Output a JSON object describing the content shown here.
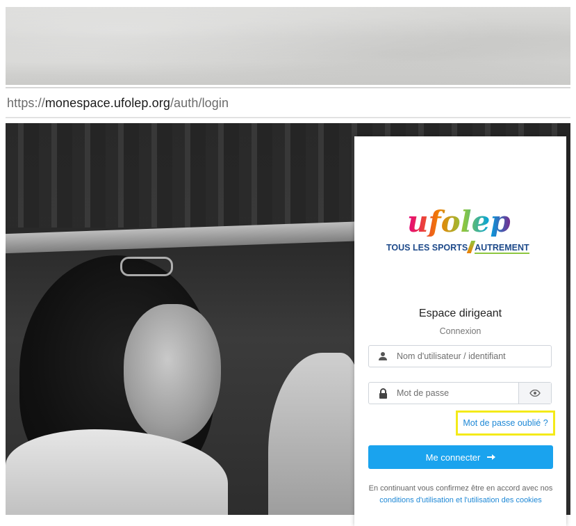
{
  "browser": {
    "url_scheme": "https://",
    "url_host": "monespace.ufolep.org",
    "url_path": "/auth/login"
  },
  "logo": {
    "wordmark": "ufolep",
    "tagline_part1": "TOUS LES SPORTS",
    "tagline_part2": "AUTREMENT"
  },
  "login": {
    "title": "Espace dirigeant",
    "subtitle": "Connexion",
    "username_placeholder": "Nom d'utilisateur / identifiant",
    "password_placeholder": "Mot de passe",
    "forgot_password": "Mot de passe oublié ?",
    "connect_button": "Me connecter",
    "legal_prefix": "En continuant vous confirmez être en accord avec nos",
    "legal_link": "conditions d'utilisation et l'utilisation des cookies"
  },
  "icons": {
    "user": "user-icon",
    "lock": "lock-icon",
    "eye": "eye-icon",
    "arrow": "arrow-right-icon"
  },
  "colors": {
    "primary_button": "#1aa3ee",
    "link": "#1e88d6",
    "highlight_box": "#f4ea19"
  }
}
